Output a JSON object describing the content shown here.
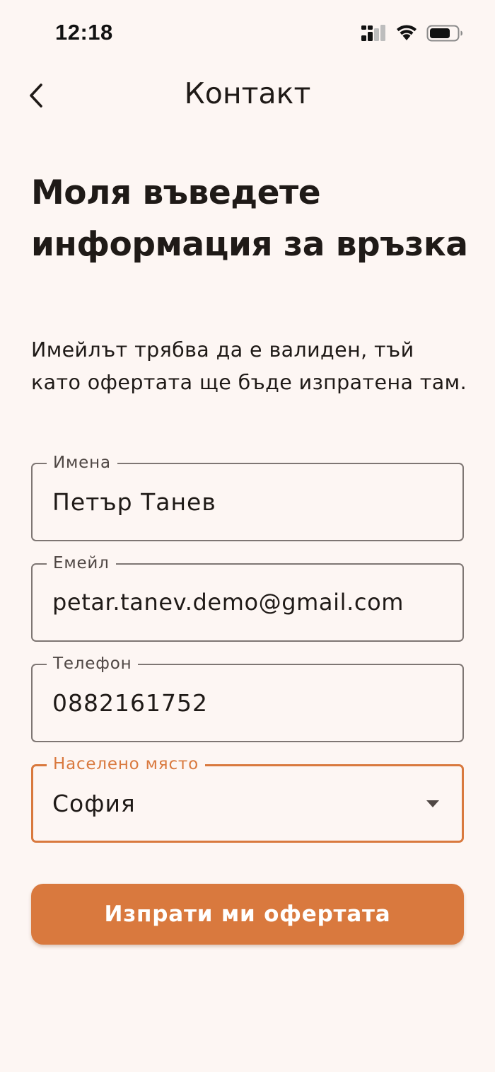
{
  "status_bar": {
    "time": "12:18"
  },
  "app_bar": {
    "title": "Контакт",
    "back_icon": "chevron-left-icon"
  },
  "content": {
    "heading": "Моля въведете информация за връзка",
    "description": "Имейлът трябва да е валиден, тъй като офертата ще бъде изпратена там."
  },
  "form": {
    "name": {
      "label": "Имена",
      "value": "Петър Танев"
    },
    "email": {
      "label": "Емейл",
      "value": "petar.tanev.demo@gmail.com"
    },
    "phone": {
      "label": "Телефон",
      "value": "0882161752"
    },
    "city": {
      "label": "Населено място",
      "value": "София",
      "icon": "arrow-drop-down-icon"
    }
  },
  "submit": {
    "label": "Изпрати ми офертата"
  },
  "colors": {
    "background": "#FDF6F3",
    "accent": "#D9793E",
    "text": "#1F1A17",
    "outline": "#7E7673"
  }
}
